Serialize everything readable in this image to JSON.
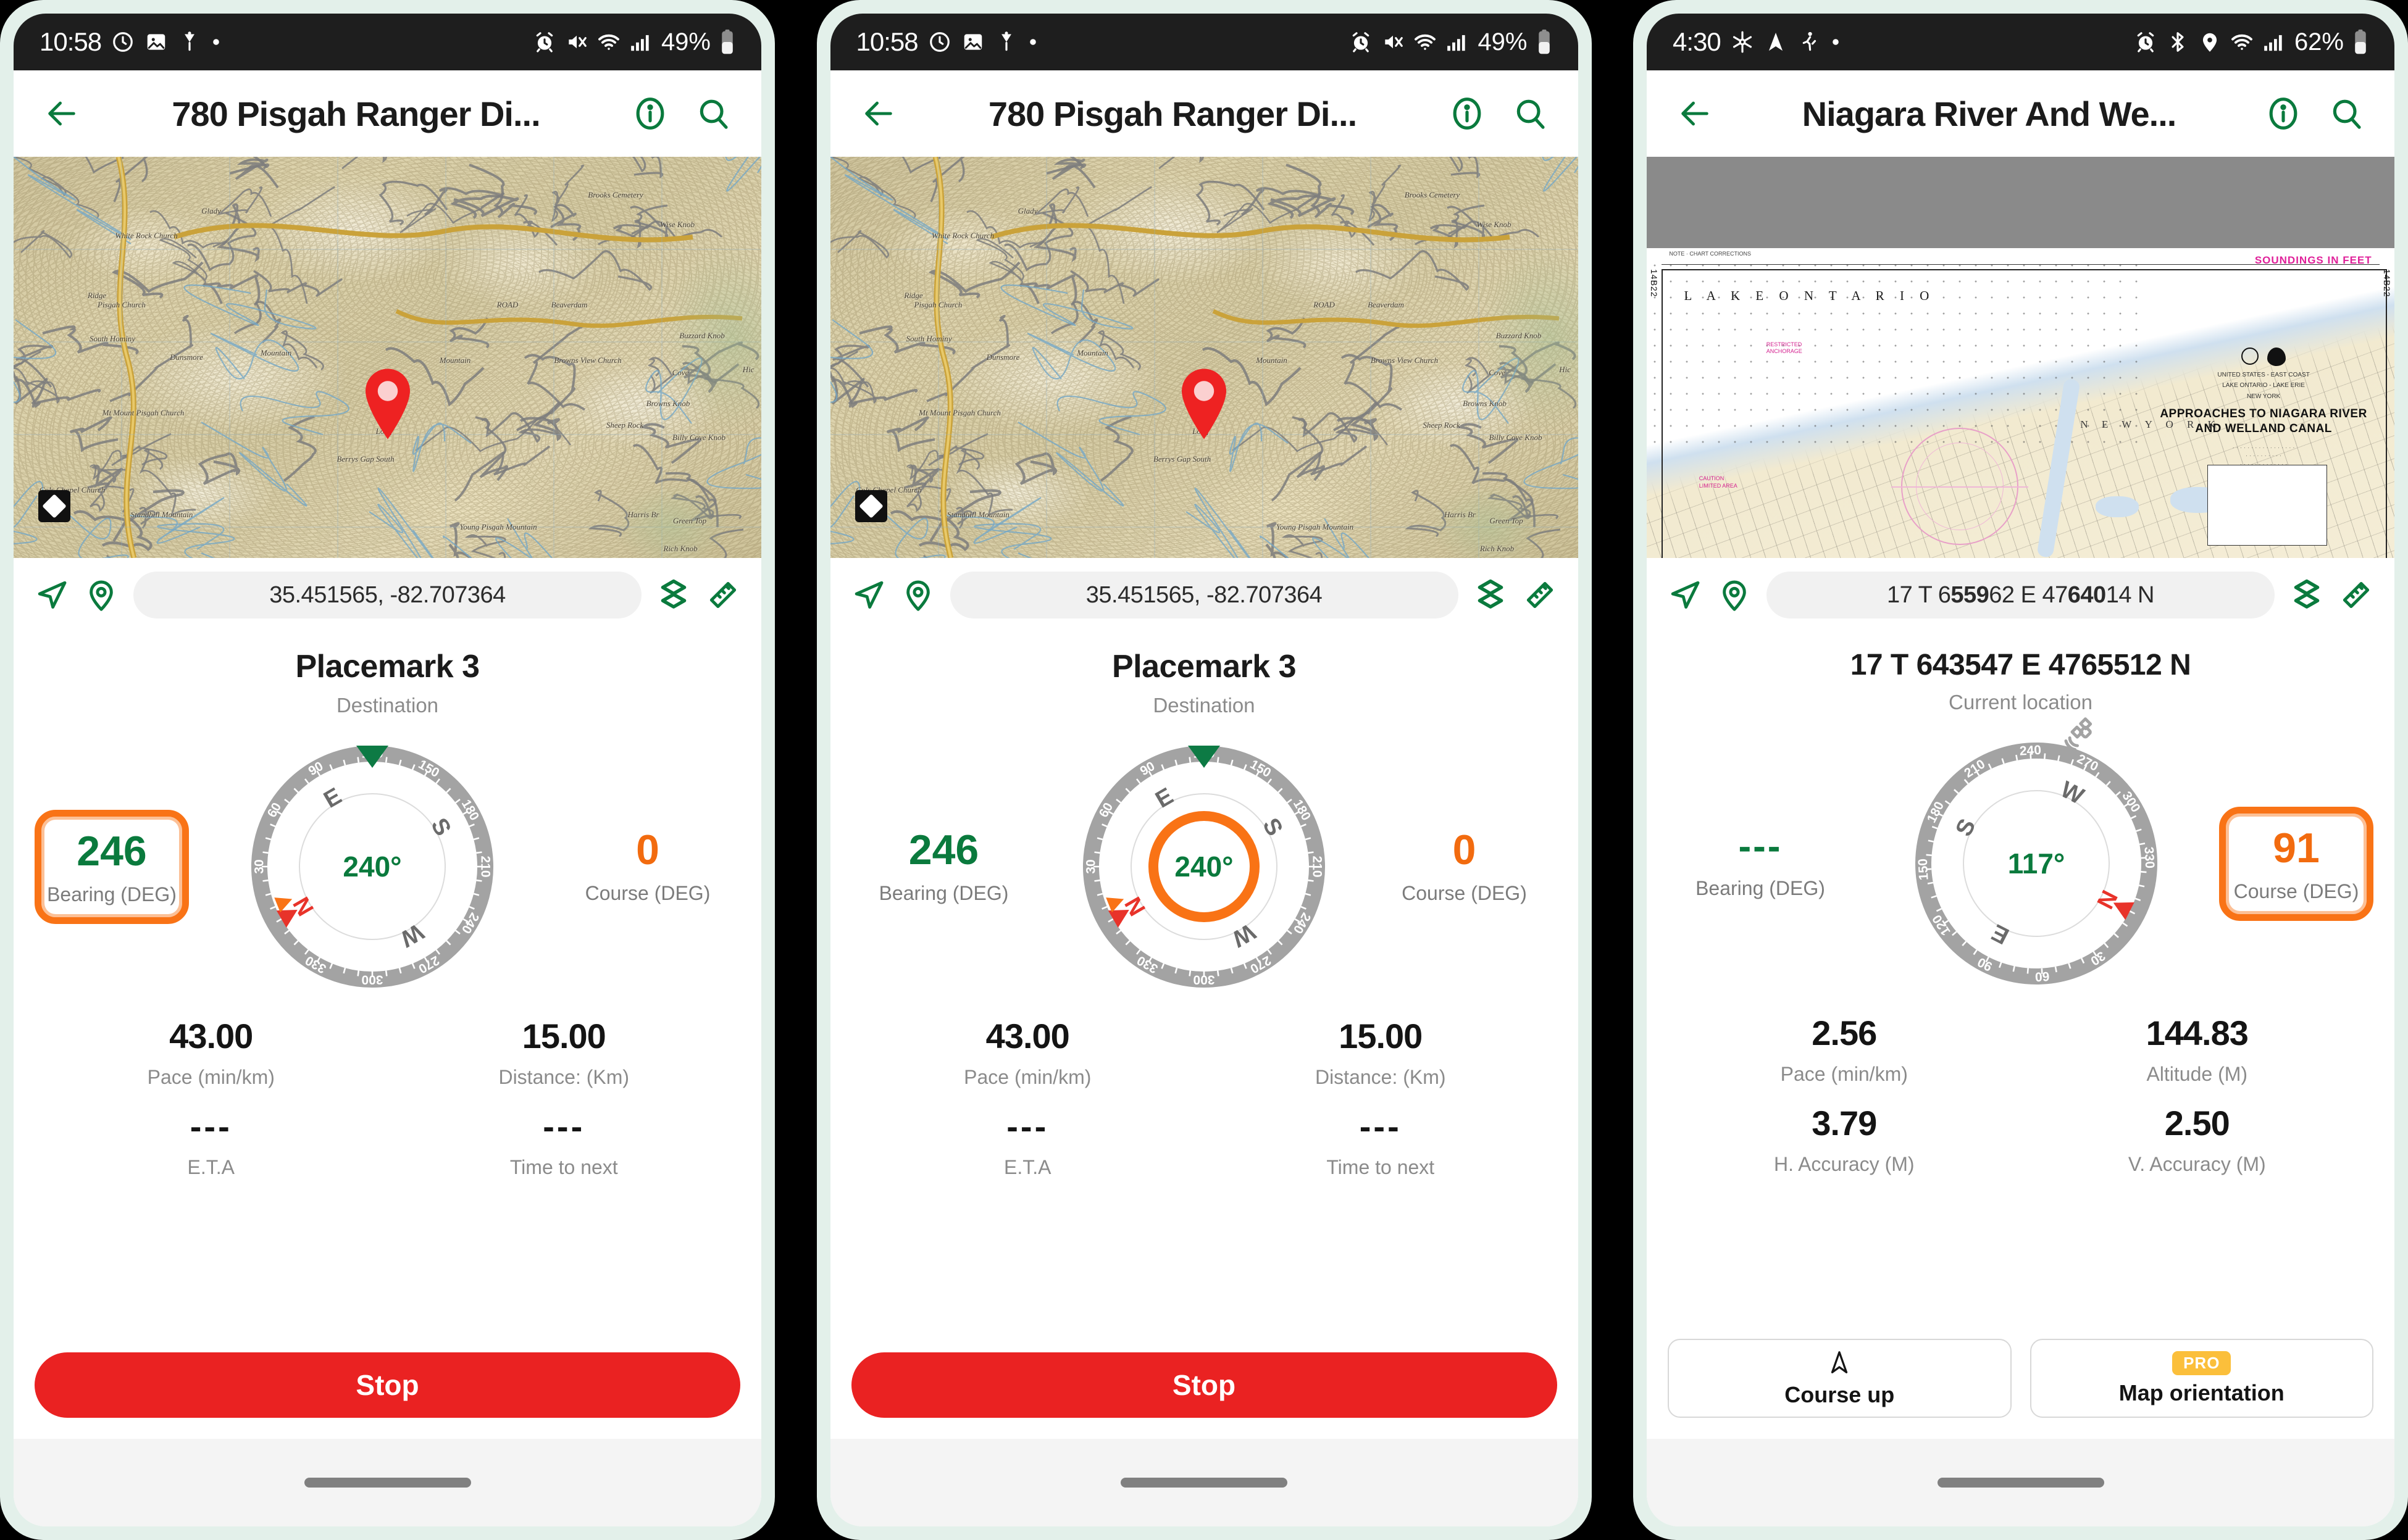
{
  "colors": {
    "green": "#0a7a3d",
    "orange": "#f26b0f",
    "orange_border": "#f97316",
    "red": "#ea2222",
    "gray_label": "#8b8b8b",
    "frame_mint": "#e3f0ea",
    "status_bar": "#1e1e1e",
    "pro_yellow": "#fbbf3b"
  },
  "panels": [
    {
      "status": {
        "time": "10:58",
        "battery": "49%",
        "left_icons": [
          "clock-outline-icon",
          "image-icon",
          "ice-cream-icon",
          "dot-icon"
        ],
        "right_icons": [
          "alarm-icon",
          "mute-icon",
          "wifi-icon",
          "signal-icon",
          "battery-icon"
        ]
      },
      "appbar": {
        "back": "back-arrow-icon",
        "title": "780 Pisgah Ranger Di...",
        "info": "info-icon",
        "search": "search-icon"
      },
      "map": {
        "type": "topo",
        "pin": "map-pin-marker",
        "badge": "highway-shield"
      },
      "coordbar": {
        "nav_icon": "navigation-arrow-icon",
        "pin_icon": "location-pin-icon",
        "value": "35.451565, -82.707364",
        "layers_icon": "layers-icon",
        "ruler_icon": "ruler-icon"
      },
      "place": {
        "name": "Placemark 3",
        "subtitle": "Destination"
      },
      "compass": {
        "heading": "240°",
        "cardinals": [
          "N",
          "E",
          "S",
          "W"
        ],
        "ticks": [
          "30",
          "60",
          "90",
          "120",
          "150",
          "180",
          "210",
          "240",
          "270",
          "300",
          "330"
        ],
        "top_marker": "green-triangle-marker",
        "north_marker": "red-triangle-marker",
        "course_marker": "orange-triangle-marker",
        "highlight_ring": false
      },
      "bearing": {
        "value": "246",
        "label": "Bearing (DEG)",
        "highlighted": true,
        "color": "green"
      },
      "course": {
        "value": "0",
        "label": "Course (DEG)",
        "highlighted": false,
        "color": "orange"
      },
      "stats": [
        {
          "value": "43.00",
          "label": "Pace (min/km)"
        },
        {
          "value": "15.00",
          "label": "Distance: (Km)"
        },
        {
          "value": "---",
          "label": "E.T.A"
        },
        {
          "value": "---",
          "label": "Time to next"
        }
      ],
      "primary_action": "Stop"
    },
    {
      "status": {
        "time": "10:58",
        "battery": "49%",
        "left_icons": [
          "clock-outline-icon",
          "image-icon",
          "ice-cream-icon",
          "dot-icon"
        ],
        "right_icons": [
          "alarm-icon",
          "mute-icon",
          "wifi-icon",
          "signal-icon",
          "battery-icon"
        ]
      },
      "appbar": {
        "back": "back-arrow-icon",
        "title": "780 Pisgah Ranger Di...",
        "info": "info-icon",
        "search": "search-icon"
      },
      "map": {
        "type": "topo",
        "pin": "map-pin-marker",
        "badge": "highway-shield"
      },
      "coordbar": {
        "nav_icon": "navigation-arrow-icon",
        "pin_icon": "location-pin-icon",
        "value": "35.451565, -82.707364",
        "layers_icon": "layers-icon",
        "ruler_icon": "ruler-icon"
      },
      "place": {
        "name": "Placemark 3",
        "subtitle": "Destination"
      },
      "compass": {
        "heading": "240°",
        "cardinals": [
          "N",
          "E",
          "S",
          "W"
        ],
        "ticks": [
          "30",
          "60",
          "90",
          "120",
          "150",
          "180",
          "210",
          "240",
          "270",
          "300",
          "330"
        ],
        "top_marker": "green-triangle-marker",
        "north_marker": "red-triangle-marker",
        "course_marker": "orange-triangle-marker",
        "highlight_ring": true
      },
      "bearing": {
        "value": "246",
        "label": "Bearing (DEG)",
        "highlighted": false,
        "color": "green"
      },
      "course": {
        "value": "0",
        "label": "Course (DEG)",
        "highlighted": false,
        "color": "orange"
      },
      "stats": [
        {
          "value": "43.00",
          "label": "Pace (min/km)"
        },
        {
          "value": "15.00",
          "label": "Distance: (Km)"
        },
        {
          "value": "---",
          "label": "E.T.A"
        },
        {
          "value": "---",
          "label": "Time to next"
        }
      ],
      "primary_action": "Stop"
    },
    {
      "status": {
        "time": "4:30",
        "battery": "62%",
        "left_icons": [
          "snowflake-icon",
          "navigation-icon",
          "walking-icon",
          "dot-icon"
        ],
        "right_icons": [
          "alarm-icon",
          "bluetooth-icon",
          "location-icon",
          "wifi-icon",
          "signal-icon",
          "battery-icon"
        ]
      },
      "appbar": {
        "back": "back-arrow-icon",
        "title": "Niagara River And We...",
        "info": "info-icon",
        "search": "search-icon"
      },
      "map": {
        "type": "nautical-chart",
        "soundings": "SOUNDINGS IN FEET",
        "lake_label": "L A K E   O N T A R I O",
        "legend_title": "APPROACHES TO NIAGARA RIVER AND WELLAND CANAL",
        "legend_country": "UNITED STATES - EAST COAST",
        "legend_region": "LAKE ONTARIO - LAKE ERIE",
        "legend_state": "NEW YORK",
        "state_label": "N E W   Y O R K",
        "edge_code_left": "14B22",
        "edge_code_right": "14B22"
      },
      "coordbar": {
        "nav_icon": "navigation-arrow-icon",
        "pin_icon": "location-pin-icon",
        "value_prefix": "17 T 6",
        "value_bold1": "559",
        "value_mid": "62 E 47",
        "value_bold2": "640",
        "value_suffix": "14 N",
        "layers_icon": "layers-icon",
        "ruler_icon": "ruler-icon"
      },
      "place": {
        "name": "17 T 643547 E 4765512 N",
        "subtitle": "Current location"
      },
      "compass": {
        "heading": "117°",
        "cardinals": [
          "N",
          "E",
          "S",
          "W"
        ],
        "ticks": [
          "30",
          "60",
          "90",
          "120",
          "150",
          "180",
          "210",
          "240",
          "270",
          "300",
          "330"
        ],
        "top_marker": null,
        "north_marker": "red-triangle-marker",
        "satellite_icon": "satellite-icon",
        "highlight_ring": false
      },
      "bearing": {
        "value": "---",
        "label": "Bearing (DEG)",
        "highlighted": false,
        "color": "green"
      },
      "course": {
        "value": "91",
        "label": "Course (DEG)",
        "highlighted": true,
        "color": "orange"
      },
      "stats": [
        {
          "value": "2.56",
          "label": "Pace (min/km)"
        },
        {
          "value": "144.83",
          "label": "Altitude (M)"
        },
        {
          "value": "3.79",
          "label": "H. Accuracy (M)"
        },
        {
          "value": "2.50",
          "label": "V. Accuracy (M)"
        }
      ],
      "actions": [
        {
          "icon": "course-up-arrow-icon",
          "label": "Course up",
          "badge": null
        },
        {
          "icon": null,
          "label": "Map orientation",
          "badge": "PRO"
        }
      ]
    }
  ]
}
